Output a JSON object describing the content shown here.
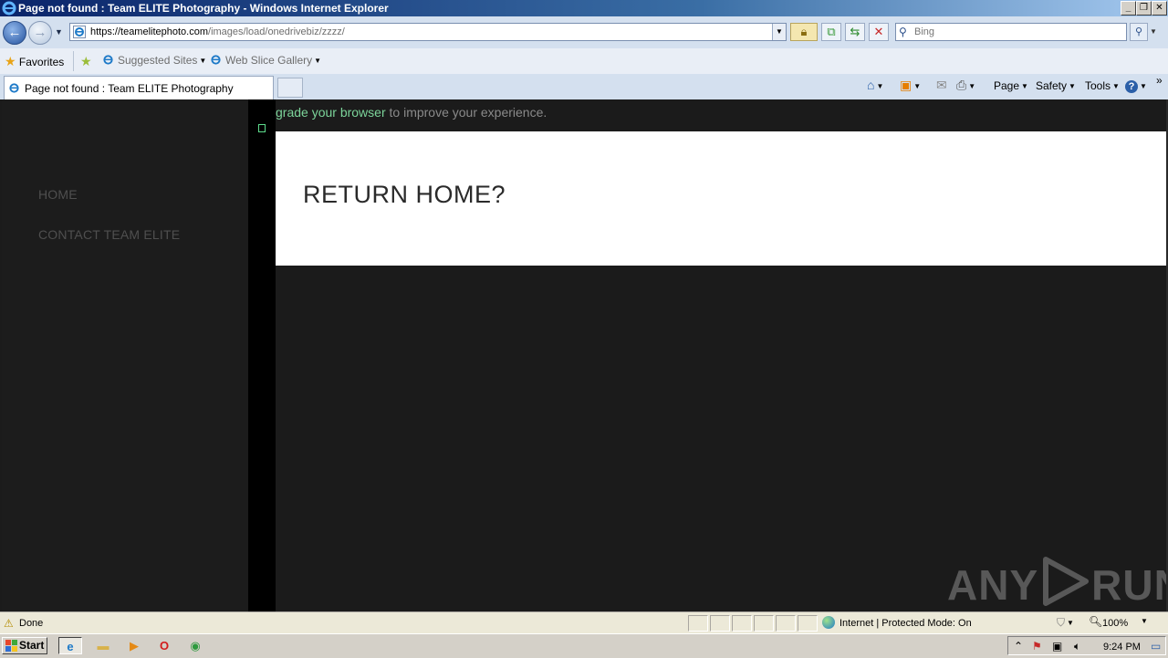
{
  "window": {
    "title": "Page not found : Team ELITE Photography - Windows Internet Explorer",
    "controls": [
      "_",
      "❐",
      "✕"
    ]
  },
  "address_bar": {
    "url_host": "https://teamelitephoto.com",
    "url_path": "/images/load/onedrivebiz/zzzz/"
  },
  "search": {
    "placeholder": "Bing"
  },
  "favorites_bar": {
    "favorites_label": "Favorites",
    "suggested_sites": "Suggested Sites",
    "web_slice_gallery": "Web Slice Gallery"
  },
  "tabs": [
    {
      "label": "Page not found : Team ELITE Photography",
      "active": true
    }
  ],
  "command_bar": {
    "page": "Page",
    "safety": "Safety",
    "tools": "Tools",
    "chevron": "»"
  },
  "page": {
    "nav": [
      {
        "label": "HOME"
      },
      {
        "label": "CONTACT TEAM ELITE"
      }
    ],
    "upgrade_link": "grade your browser",
    "upgrade_rest": " to improve your experience.",
    "return_home": "RETURN HOME?",
    "colors": {
      "background": "#1b1b1b",
      "nav_text": "#4f4f4f",
      "link_green": "#7cd49a",
      "panel_white": "#ffffff"
    }
  },
  "watermark": {
    "left": "ANY",
    "right": "RUN"
  },
  "status_bar": {
    "status": "Done",
    "zone": "Internet | Protected Mode: On",
    "zoom": "100%"
  },
  "taskbar": {
    "start_label": "Start",
    "clock": "9:24 PM",
    "apps": [
      {
        "icon": "internet-explorer-icon",
        "active": true
      },
      {
        "icon": "folder-icon",
        "active": false
      },
      {
        "icon": "media-player-icon",
        "active": false
      },
      {
        "icon": "opera-icon",
        "active": false
      },
      {
        "icon": "chrome-icon",
        "active": false
      }
    ]
  }
}
